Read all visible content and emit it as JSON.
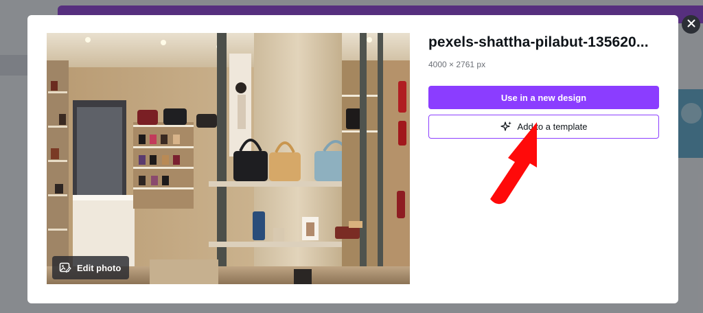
{
  "modal": {
    "image": {
      "title": "pexels-shattha-pilabut-135620...",
      "dimensions": "4000 × 2761 px",
      "edit_button_label": "Edit photo"
    },
    "actions": {
      "primary_label": "Use in a new design",
      "secondary_label": "Add to a template"
    }
  },
  "icons": {
    "close": "close-icon",
    "edit_photo": "image-edit-icon",
    "sparkle": "sparkle-icon",
    "annotation": "red-arrow-annotation"
  },
  "colors": {
    "accent": "#8b3dff",
    "annotation": "#ff0a0a",
    "title_text": "#0e1318",
    "secondary_text": "#6b6f76"
  }
}
